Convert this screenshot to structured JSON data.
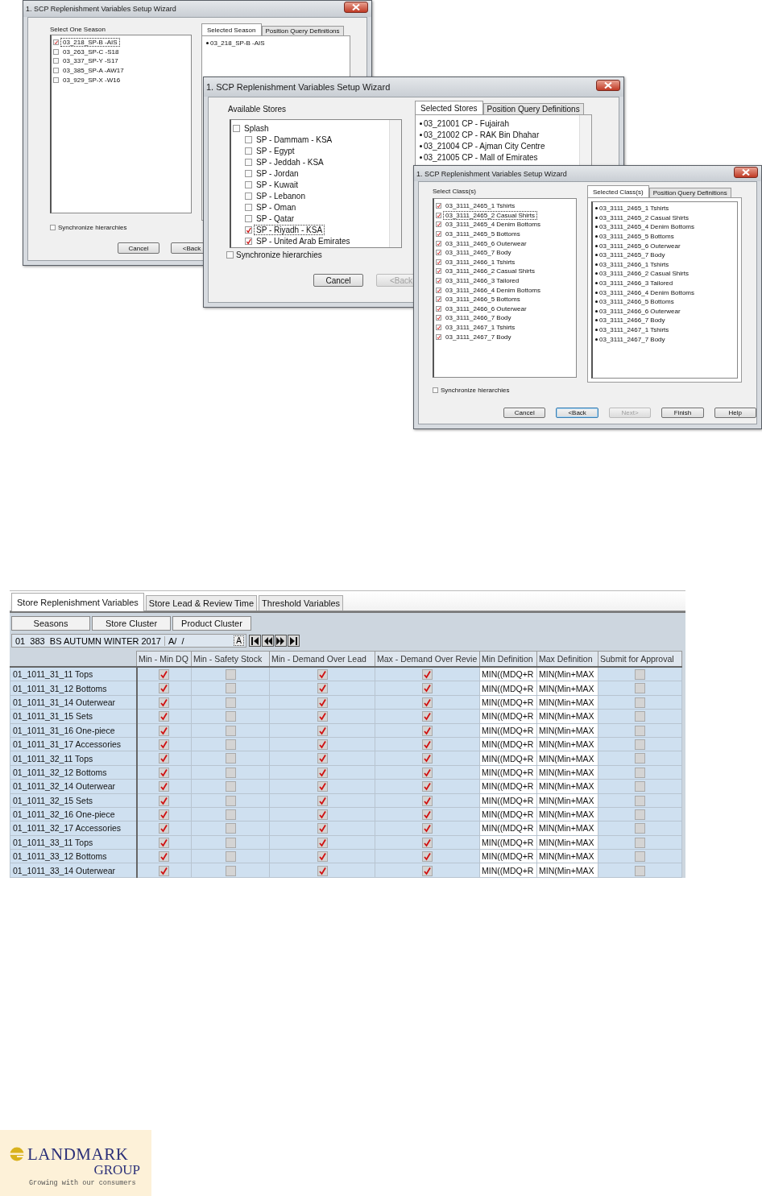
{
  "wizards": [
    {
      "title": "1. SCP Replenishment Variables Setup Wizard",
      "list_label": "Select One Season",
      "items": [
        {
          "label": "03_218_SP-B -AIS",
          "checked": true,
          "focused": true
        },
        {
          "label": "03_263_SP-C -S18",
          "checked": false,
          "focused": false
        },
        {
          "label": "03_337_SP-Y -S17",
          "checked": false,
          "focused": false
        },
        {
          "label": "03_385_SP-A -AW17",
          "checked": false,
          "focused": false
        },
        {
          "label": "03_929_SP-X -W16",
          "checked": false,
          "focused": false
        }
      ],
      "tabs": [
        {
          "label": "Selected Season",
          "selected": true
        },
        {
          "label": "Position Query Definitions",
          "selected": false
        }
      ],
      "selected_items": [
        "03_218_SP-B -AIS"
      ],
      "sync": {
        "label": "Synchronize hierarchies",
        "checked": false
      },
      "buttons": [
        {
          "label": "Cancel",
          "disabled": false,
          "default": false
        },
        {
          "label": "<Back",
          "disabled": false,
          "default": false
        }
      ]
    },
    {
      "title": "1. SCP Replenishment Variables Setup Wizard",
      "list_label": "Available Stores",
      "items": [
        {
          "label": "Splash",
          "checked": false,
          "focused": false,
          "children": [
            {
              "label": "SP - Dammam - KSA",
              "checked": false,
              "focused": false
            },
            {
              "label": "SP - Egypt",
              "checked": false,
              "focused": false
            },
            {
              "label": "SP - Jeddah - KSA",
              "checked": false,
              "focused": false
            },
            {
              "label": "SP - Jordan",
              "checked": false,
              "focused": false
            },
            {
              "label": "SP - Kuwait",
              "checked": false,
              "focused": false
            },
            {
              "label": "SP - Lebanon",
              "checked": false,
              "focused": false
            },
            {
              "label": "SP - Oman",
              "checked": false,
              "focused": false
            },
            {
              "label": "SP - Qatar",
              "checked": false,
              "focused": false
            },
            {
              "label": "SP - Riyadh - KSA",
              "checked": true,
              "focused": true
            },
            {
              "label": "SP - United Arab Emirates",
              "checked": true,
              "focused": false
            }
          ]
        }
      ],
      "tabs": [
        {
          "label": "Selected Stores",
          "selected": true
        },
        {
          "label": "Position Query Definitions",
          "selected": false
        }
      ],
      "selected_items": [
        "03_21001 CP - Fujairah",
        "03_21002 CP - RAK Bin Dhahar",
        "03_21004 CP - Ajman City Centre",
        "03_21005 CP - Mall of Emirates"
      ],
      "sync": {
        "label": "Synchronize hierarchies",
        "checked": false
      },
      "buttons": [
        {
          "label": "Cancel",
          "disabled": false,
          "default": false
        },
        {
          "label": "<Back",
          "disabled": true,
          "default": false
        }
      ]
    },
    {
      "title": "1. SCP Replenishment Variables Setup Wizard",
      "list_label": "Select Class(s)",
      "items": [
        {
          "label": "03_3111_2465_1 Tshirts",
          "checked": true,
          "focused": false
        },
        {
          "label": "03_3111_2465_2 Casual Shirts",
          "checked": true,
          "focused": true
        },
        {
          "label": "03_3111_2465_4 Denim Bottoms",
          "checked": true,
          "focused": false
        },
        {
          "label": "03_3111_2465_5 Bottoms",
          "checked": true,
          "focused": false
        },
        {
          "label": "03_3111_2465_6 Outerwear",
          "checked": true,
          "focused": false
        },
        {
          "label": "03_3111_2465_7 Body",
          "checked": true,
          "focused": false
        },
        {
          "label": "03_3111_2466_1 Tshirts",
          "checked": true,
          "focused": false
        },
        {
          "label": "03_3111_2466_2 Casual Shirts",
          "checked": true,
          "focused": false
        },
        {
          "label": "03_3111_2466_3 Tailored",
          "checked": true,
          "focused": false
        },
        {
          "label": "03_3111_2466_4 Denim Bottoms",
          "checked": true,
          "focused": false
        },
        {
          "label": "03_3111_2466_5 Bottoms",
          "checked": true,
          "focused": false
        },
        {
          "label": "03_3111_2466_6 Outerwear",
          "checked": true,
          "focused": false
        },
        {
          "label": "03_3111_2466_7 Body",
          "checked": true,
          "focused": false
        },
        {
          "label": "03_3111_2467_1 Tshirts",
          "checked": true,
          "focused": false
        },
        {
          "label": "03_3111_2467_7 Body",
          "checked": true,
          "focused": false
        }
      ],
      "tabs": [
        {
          "label": "Selected Class(s)",
          "selected": true
        },
        {
          "label": "Position Query Definitions",
          "selected": false
        }
      ],
      "selected_items": [
        "03_3111_2465_1 Tshirts",
        "03_3111_2465_2 Casual Shirts",
        "03_3111_2465_4 Denim Bottoms",
        "03_3111_2465_5 Bottoms",
        "03_3111_2465_6 Outerwear",
        "03_3111_2465_7 Body",
        "03_3111_2466_1 Tshirts",
        "03_3111_2466_2 Casual Shirts",
        "03_3111_2466_3 Tailored",
        "03_3111_2466_4 Denim Bottoms",
        "03_3111_2466_5 Bottoms",
        "03_3111_2466_6 Outerwear",
        "03_3111_2466_7 Body",
        "03_3111_2467_1 Tshirts",
        "03_3111_2467_7 Body"
      ],
      "sync": {
        "label": "Synchronize hierarchies",
        "checked": false
      },
      "buttons": [
        {
          "label": "Cancel",
          "disabled": false,
          "default": false
        },
        {
          "label": "<Back",
          "disabled": false,
          "default": true
        },
        {
          "label": "Next>",
          "disabled": true,
          "default": false
        },
        {
          "label": "Finish",
          "disabled": false,
          "default": false
        },
        {
          "label": "Help",
          "disabled": false,
          "default": false
        }
      ]
    }
  ],
  "variables": {
    "tabs": [
      {
        "label": "Store Replenishment Variables",
        "selected": true
      },
      {
        "label": "Store Lead & Review Time",
        "selected": false
      },
      {
        "label": "Threshold Variables",
        "selected": false
      }
    ],
    "buttons": [
      "Seasons",
      "Store Cluster",
      "Product Cluster"
    ],
    "season": {
      "name": "01  383  BS AUTUMN WINTER 2017",
      "date": "A/  /",
      "glyph": "A"
    },
    "columns": [
      {
        "kind": "text"
      },
      {
        "kind": "check",
        "label": "Min - Min DQ"
      },
      {
        "kind": "check",
        "label": "Min - Safety Stock"
      },
      {
        "kind": "check",
        "label": "Min - Demand Over Lead"
      },
      {
        "kind": "check",
        "label": "Max - Demand Over Revie"
      },
      {
        "kind": "formula",
        "label": "Min Definition"
      },
      {
        "kind": "formula",
        "label": "Max Definition"
      },
      {
        "kind": "check",
        "label": "Submit for Approval"
      }
    ],
    "rows": [
      [
        "01_1011_31_11 Tops",
        true,
        false,
        true,
        true,
        "MIN((MDQ+R",
        "MIN(Min+MAX",
        false
      ],
      [
        "01_1011_31_12 Bottoms",
        true,
        false,
        true,
        true,
        "MIN((MDQ+R",
        "MIN(Min+MAX",
        false
      ],
      [
        "01_1011_31_14 Outerwear",
        true,
        false,
        true,
        true,
        "MIN((MDQ+R",
        "MIN(Min+MAX",
        false
      ],
      [
        "01_1011_31_15 Sets",
        true,
        false,
        true,
        true,
        "MIN((MDQ+R",
        "MIN(Min+MAX",
        false
      ],
      [
        "01_1011_31_16 One-piece",
        true,
        false,
        true,
        true,
        "MIN((MDQ+R",
        "MIN(Min+MAX",
        false
      ],
      [
        "01_1011_31_17 Accessories",
        true,
        false,
        true,
        true,
        "MIN((MDQ+R",
        "MIN(Min+MAX",
        false
      ],
      [
        "01_1011_32_11 Tops",
        true,
        false,
        true,
        true,
        "MIN((MDQ+R",
        "MIN(Min+MAX",
        false
      ],
      [
        "01_1011_32_12 Bottoms",
        true,
        false,
        true,
        true,
        "MIN((MDQ+R",
        "MIN(Min+MAX",
        false
      ],
      [
        "01_1011_32_14 Outerwear",
        true,
        false,
        true,
        true,
        "MIN((MDQ+R",
        "MIN(Min+MAX",
        false
      ],
      [
        "01_1011_32_15 Sets",
        true,
        false,
        true,
        true,
        "MIN((MDQ+R",
        "MIN(Min+MAX",
        false
      ],
      [
        "01_1011_32_16 One-piece",
        true,
        false,
        true,
        true,
        "MIN((MDQ+R",
        "MIN(Min+MAX",
        false
      ],
      [
        "01_1011_32_17 Accessories",
        true,
        false,
        true,
        true,
        "MIN((MDQ+R",
        "MIN(Min+MAX",
        false
      ],
      [
        "01_1011_33_11 Tops",
        true,
        false,
        true,
        true,
        "MIN((MDQ+R",
        "MIN(Min+MAX",
        false
      ],
      [
        "01_1011_33_12 Bottoms",
        true,
        false,
        true,
        true,
        "MIN((MDQ+R",
        "MIN(Min+MAX",
        false
      ],
      [
        "01_1011_33_14 Outerwear",
        true,
        false,
        true,
        true,
        "MIN((MDQ+R",
        "MIN(Min+MAX",
        false
      ]
    ]
  },
  "logo": {
    "name": "LANDMARK",
    "group": "GROUP",
    "tagline": "Growing with our consumers"
  }
}
